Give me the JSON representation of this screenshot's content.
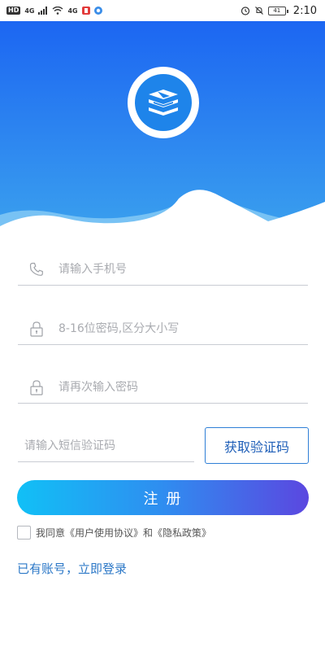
{
  "status_bar": {
    "left_badges": [
      "HD",
      "4G",
      "4G"
    ],
    "time": "2:10",
    "battery": "41"
  },
  "header": {
    "logo_icon": "stacked-books-icon",
    "colors": {
      "top": "#1c66f2",
      "bottom": "#3aa0ee",
      "logo_inner": "#1e84ea"
    }
  },
  "form": {
    "phone": {
      "placeholder": "请输入手机号",
      "icon": "phone-icon"
    },
    "password": {
      "placeholder": "8-16位密码,区分大小写",
      "icon": "lock-icon"
    },
    "confirm_password": {
      "placeholder": "请再次输入密码",
      "icon": "lock-icon"
    },
    "sms_code": {
      "placeholder": "请输入短信验证码"
    },
    "get_code_label": "获取验证码",
    "register_label": "注册",
    "agreement_text": "我同意《用户使用协议》和《隐私政策》",
    "login_link": "已有账号，立即登录"
  },
  "colors": {
    "register_gradient": [
      "#11c0f6",
      "#2f8df0",
      "#5b47e0"
    ],
    "link": "#2c78c7",
    "code_button_border": "#2f7fd6"
  }
}
